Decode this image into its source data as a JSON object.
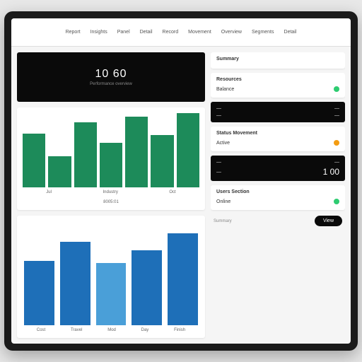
{
  "nav": {
    "items": [
      "Report",
      "Insights",
      "Panel",
      "Detail",
      "Record",
      "Movement",
      "Overview",
      "Segments",
      "Detail"
    ]
  },
  "hero": {
    "value": "10 60",
    "subtitle": "Performance overview"
  },
  "chart_data": [
    {
      "type": "bar",
      "title": "",
      "categories": [
        "Jul",
        "Industry",
        "Oct"
      ],
      "values": [
        72,
        42,
        88,
        60,
        95,
        70,
        100
      ],
      "ylim": [
        0,
        100
      ],
      "color": "#1d8b5a",
      "footer_labels": [
        "Jul",
        "Industry",
        "Oct"
      ],
      "footer_secondary": "8005:01"
    },
    {
      "type": "bar",
      "title": "",
      "categories": [
        "Cost",
        "Travel",
        "Mod",
        "Day",
        "Finish"
      ],
      "values": [
        62,
        80,
        60,
        72,
        88
      ],
      "ylim": [
        0,
        100
      ],
      "colors": [
        "#1e6fb8",
        "#1e6fb8",
        "#4a9fd8",
        "#1e6fb8",
        "#1e6fb8"
      ]
    }
  ],
  "sidebar": {
    "section1_title": "Summary",
    "card1": {
      "title": "Resources",
      "rows": [
        {
          "label": "Balance",
          "status": "green"
        }
      ]
    },
    "darkcard1": {
      "rows": [
        {
          "label": "",
          "value": ""
        },
        {
          "label": "",
          "value": ""
        }
      ]
    },
    "card2": {
      "title": "Status Movement",
      "rows": [
        {
          "label": "Active",
          "status": "amber"
        }
      ]
    },
    "darkcard2": {
      "rows": [
        {
          "label": "",
          "value": ""
        },
        {
          "label": "",
          "value_big": "1 00"
        }
      ]
    },
    "card3": {
      "title": "Users Section",
      "rows": [
        {
          "label": "Online",
          "status": "green"
        }
      ]
    },
    "footer_label": "Summary",
    "button_label": "View"
  }
}
